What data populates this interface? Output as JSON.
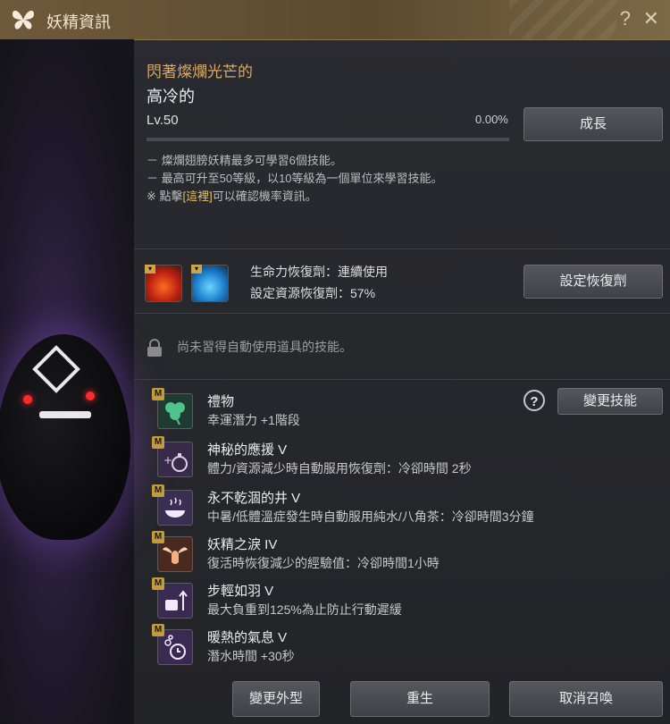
{
  "window": {
    "title": "妖精資訊",
    "help_label": "?",
    "close_label": "✕"
  },
  "fairy": {
    "subtitle": "閃著燦爛光芒的",
    "name": "高冷的",
    "level": "Lv.50",
    "progress_text": "0.00%",
    "progress": 0.0
  },
  "buttons": {
    "grow": "成長",
    "set_potion": "設定恢復劑",
    "change_skill": "變更技能",
    "change_look": "變更外型",
    "rebirth": "重生",
    "unsummon": "取消召喚",
    "question": "?"
  },
  "notes": {
    "line1": "－ 燦爛翅膀妖精最多可學習6個技能。",
    "line2": "－ 最高可升至50等級，以10等級為一個單位來學習技能。",
    "line3_pre": "※ 點擊",
    "line3_link": "[這裡]",
    "line3_post": "可以確認機率資訊。"
  },
  "recovery": {
    "line1": "生命力恢復劑：連續使用",
    "line2": "設定資源恢復劑：57%"
  },
  "auto_use": {
    "text": "尚未習得自動使用道具的技能。"
  },
  "skills": [
    {
      "badge": "M",
      "name": "禮物",
      "desc": "幸運潛力 +1階段",
      "icon": "clover-icon"
    },
    {
      "badge": "M",
      "name": "神秘的應援 V",
      "desc": "體力/資源減少時自動服用恢復劑：冷卻時間 2秒",
      "icon": "potion-flask-icon"
    },
    {
      "badge": "M",
      "name": "永不乾涸的井 V",
      "desc": "中暑/低體溫症發生時自動服用純水/八角茶：冷卻時間3分鐘",
      "icon": "steaming-bowl-icon"
    },
    {
      "badge": "M",
      "name": "妖精之淚 IV",
      "desc": "復活時恢復減少的經驗值：冷卻時間1小時",
      "icon": "winged-vase-icon"
    },
    {
      "badge": "M",
      "name": "步輕如羽 V",
      "desc": "最大負重到125%為止防止行動遲緩",
      "icon": "weight-arrow-icon"
    },
    {
      "badge": "M",
      "name": "暖熱的氣息 V",
      "desc": "潛水時間 +30秒",
      "icon": "bubble-timer-icon"
    }
  ],
  "colors": {
    "title_bar": "#6e5a3a",
    "accent_gold": "#d4a96a",
    "badge_gold": "#c49b3a",
    "eye_red": "#ff2a2a"
  }
}
